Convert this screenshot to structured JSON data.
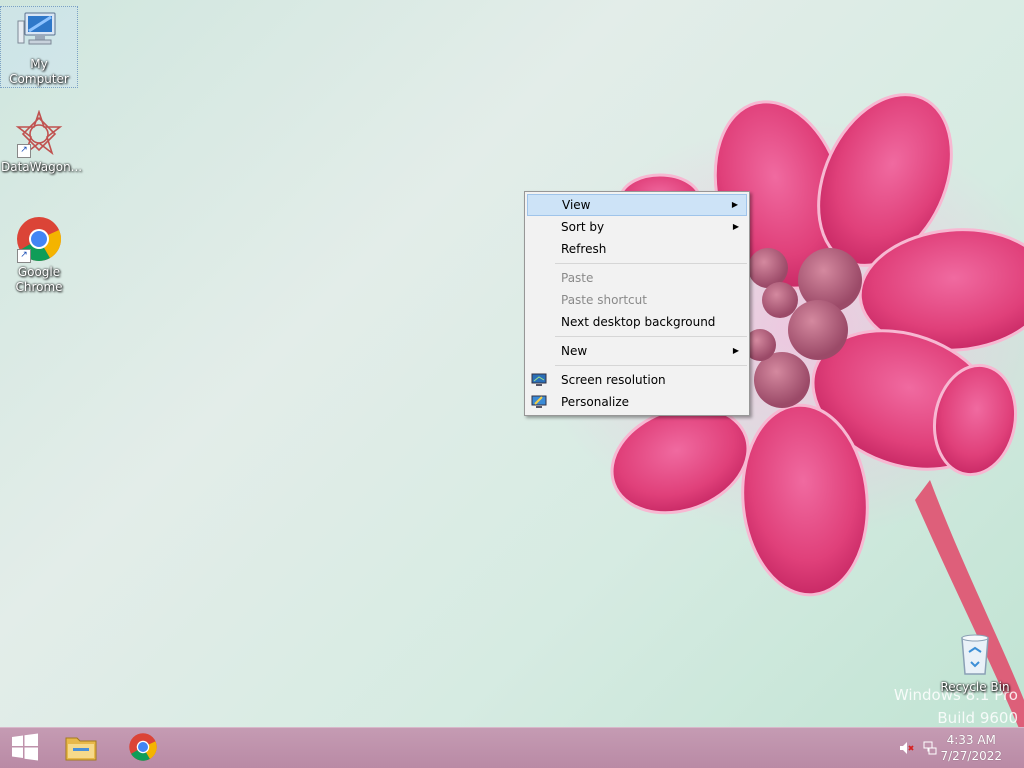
{
  "desktop": {
    "icons": [
      {
        "label": "My Computer",
        "icon": "computer-icon"
      },
      {
        "label": "DataWagon...",
        "icon": "datawagon-icon"
      },
      {
        "label": "Google Chrome",
        "icon": "chrome-icon"
      },
      {
        "label": "Recycle Bin",
        "icon": "recycle-bin-icon"
      }
    ],
    "watermark": {
      "line1": "Windows 8.1 Pro",
      "line2": "Build 9600"
    }
  },
  "context_menu": {
    "items": [
      {
        "label": "View",
        "submenu": true,
        "state": "hover"
      },
      {
        "label": "Sort by",
        "submenu": true
      },
      {
        "label": "Refresh"
      },
      {
        "label": "Paste",
        "state": "disabled"
      },
      {
        "label": "Paste shortcut",
        "state": "disabled"
      },
      {
        "label": "Next desktop background"
      },
      {
        "label": "New",
        "submenu": true
      },
      {
        "label": "Screen resolution",
        "icon": "monitor-icon"
      },
      {
        "label": "Personalize",
        "icon": "personalize-icon"
      }
    ],
    "submenu_arrow": "▶"
  },
  "taskbar": {
    "buttons": [
      {
        "name": "start",
        "icon": "windows-logo-icon"
      },
      {
        "name": "file-explorer",
        "icon": "folder-icon"
      },
      {
        "name": "chrome",
        "icon": "chrome-icon"
      }
    ],
    "tray": {
      "icons": [
        "speaker-muted-icon",
        "network-icon"
      ],
      "time": "4:33 AM",
      "date": "7/27/2022"
    }
  },
  "colors": {
    "taskbar": "#bd8fa9",
    "menu_hover": "#cde3f7",
    "flower": "#e0457f"
  }
}
